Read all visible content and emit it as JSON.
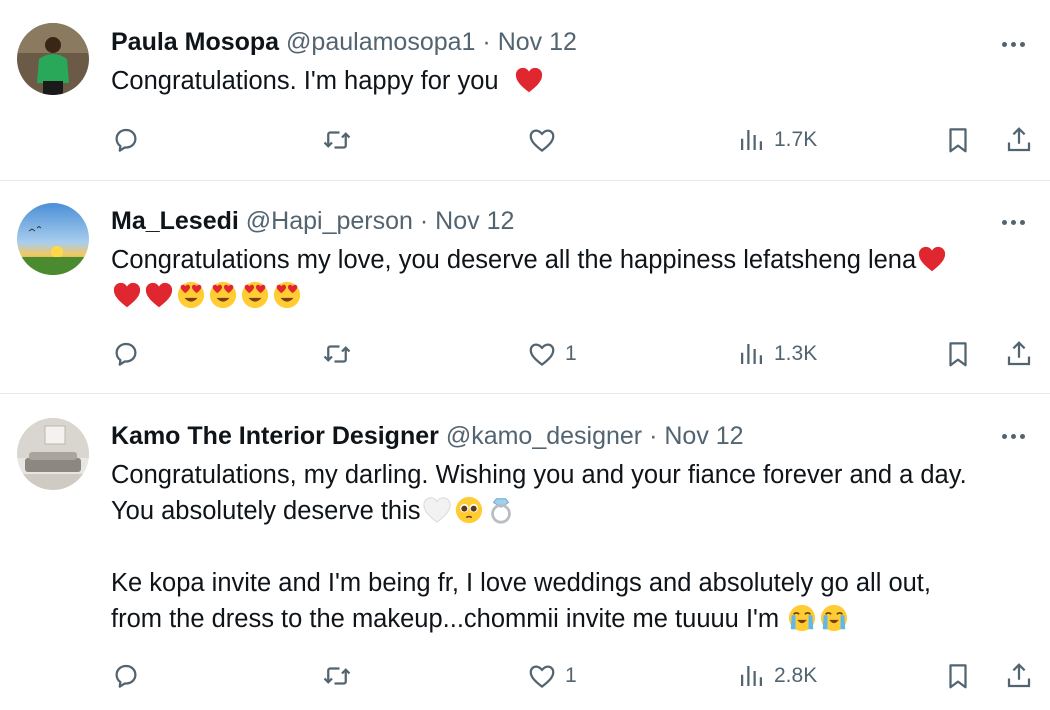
{
  "icons": {
    "reply": "reply-icon",
    "retweet": "retweet-icon",
    "like": "heart-outline-icon",
    "views": "views-bar-chart-icon",
    "bookmark": "bookmark-icon",
    "share": "share-icon",
    "more": "more-options-icon"
  },
  "colors": {
    "text": "#0f1419",
    "secondary": "#536471",
    "divider": "#e7e9ea",
    "heart_red": "#e0262f"
  },
  "tweets": [
    {
      "name": "Paula Mosopa",
      "handle": "@paulamosopa1",
      "separator": "·",
      "date": "Nov 12",
      "lines": [
        "Congratulations. I'm happy for you"
      ],
      "emojis": [
        "red-heart"
      ],
      "replies": "",
      "retweets": "",
      "likes": "",
      "views": "1.7K"
    },
    {
      "name": "Ma_Lesedi",
      "handle": "@Hapi_person",
      "separator": "·",
      "date": "Nov 12",
      "lines": [
        "Congratulations my love, you deserve all the happiness lefatsheng lena"
      ],
      "emojis": [
        "red-heart",
        "red-heart",
        "red-heart",
        "heart-eyes",
        "heart-eyes",
        "heart-eyes",
        "heart-eyes"
      ],
      "replies": "",
      "retweets": "",
      "likes": "1",
      "views": "1.3K"
    },
    {
      "name": "Kamo The Interior Designer",
      "handle": "@kamo_designer",
      "separator": "·",
      "date": "Nov 12",
      "lines": [
        "Congratulations, my darling. Wishing you and your fiance forever and a day.",
        "You absolutely deserve this",
        "Ke kopa invite and I'm being fr, I love weddings and absolutely go all out,",
        "from the dress to the makeup...chommii invite me tuuuu I'm"
      ],
      "emojis": [
        "white-heart",
        "pleading-face",
        "ring",
        "loudly-crying-face",
        "loudly-crying-face"
      ],
      "replies": "",
      "retweets": "",
      "likes": "1",
      "views": "2.8K"
    }
  ]
}
